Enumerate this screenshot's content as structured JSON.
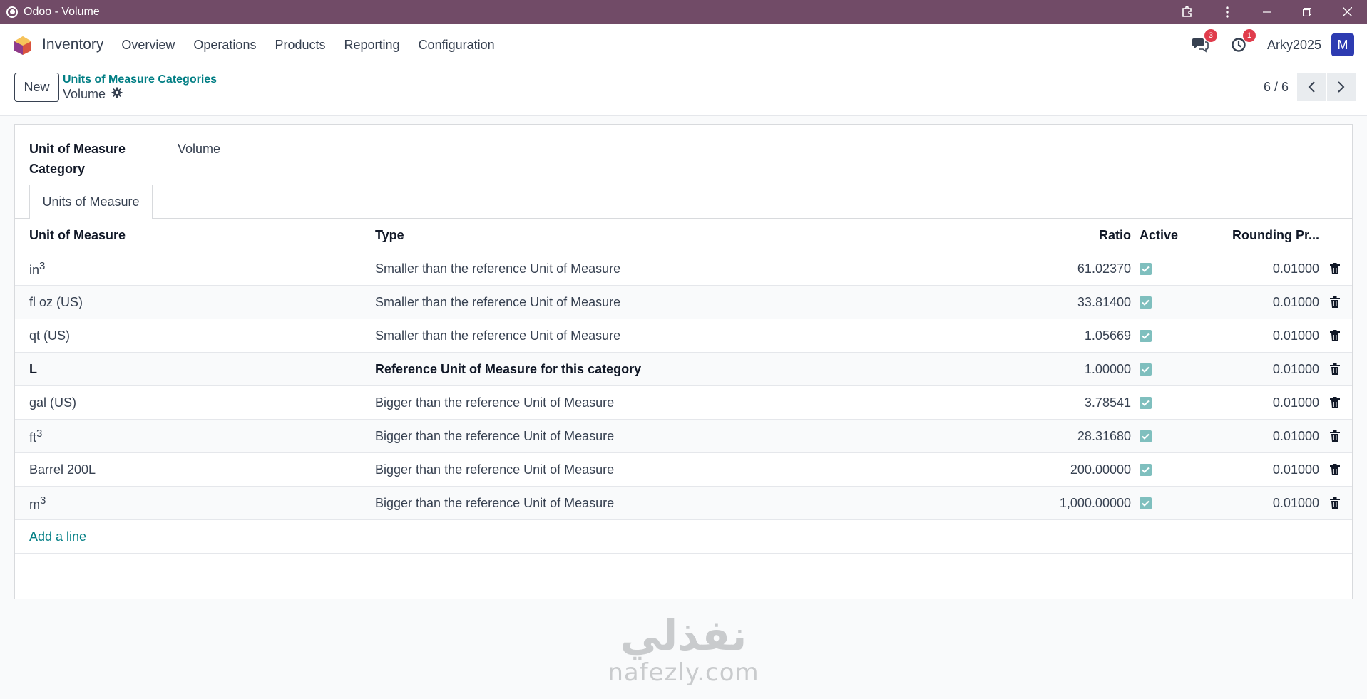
{
  "window": {
    "title": "Odoo - Volume"
  },
  "navbar": {
    "app_name": "Inventory",
    "menu": [
      "Overview",
      "Operations",
      "Products",
      "Reporting",
      "Configuration"
    ],
    "messages_badge": "3",
    "activities_badge": "1",
    "user_name": "Arky2025",
    "avatar_letter": "M"
  },
  "control": {
    "new_label": "New",
    "breadcrumb": "Units of Measure Categories",
    "record_title": "Volume",
    "pager": "6 / 6"
  },
  "form": {
    "category_label": "Unit of Measure Category",
    "category_value": "Volume",
    "tab_label": "Units of Measure"
  },
  "table": {
    "headers": {
      "uom": "Unit of Measure",
      "type": "Type",
      "ratio": "Ratio",
      "active": "Active",
      "rounding": "Rounding Pr..."
    },
    "rows": [
      {
        "uom": "in",
        "sup": "3",
        "type": "Smaller than the reference Unit of Measure",
        "ratio": "61.02370",
        "active": true,
        "rounding": "0.01000"
      },
      {
        "uom": "fl oz (US)",
        "sup": "",
        "type": "Smaller than the reference Unit of Measure",
        "ratio": "33.81400",
        "active": true,
        "rounding": "0.01000"
      },
      {
        "uom": "qt (US)",
        "sup": "",
        "type": "Smaller than the reference Unit of Measure",
        "ratio": "1.05669",
        "active": true,
        "rounding": "0.01000"
      },
      {
        "uom": "L",
        "sup": "",
        "type": "Reference Unit of Measure for this category",
        "ratio": "1.00000",
        "active": true,
        "rounding": "0.01000",
        "reference": true
      },
      {
        "uom": "gal (US)",
        "sup": "",
        "type": "Bigger than the reference Unit of Measure",
        "ratio": "3.78541",
        "active": true,
        "rounding": "0.01000"
      },
      {
        "uom": "ft",
        "sup": "3",
        "type": "Bigger than the reference Unit of Measure",
        "ratio": "28.31680",
        "active": true,
        "rounding": "0.01000"
      },
      {
        "uom": "Barrel 200L",
        "sup": "",
        "type": "Bigger than the reference Unit of Measure",
        "ratio": "200.00000",
        "active": true,
        "rounding": "0.01000"
      },
      {
        "uom": "m",
        "sup": "3",
        "type": "Bigger than the reference Unit of Measure",
        "ratio": "1,000.00000",
        "active": true,
        "rounding": "0.01000"
      }
    ],
    "add_line": "Add a line"
  },
  "watermark": {
    "arabic": "نفذلي",
    "latin": "nafezly.com"
  },
  "colors": {
    "titlebar": "#714b67",
    "link": "#017e84",
    "avatar": "#2d3bb1",
    "checkbox": "#7fbfbe",
    "badge": "#e03c4c"
  }
}
